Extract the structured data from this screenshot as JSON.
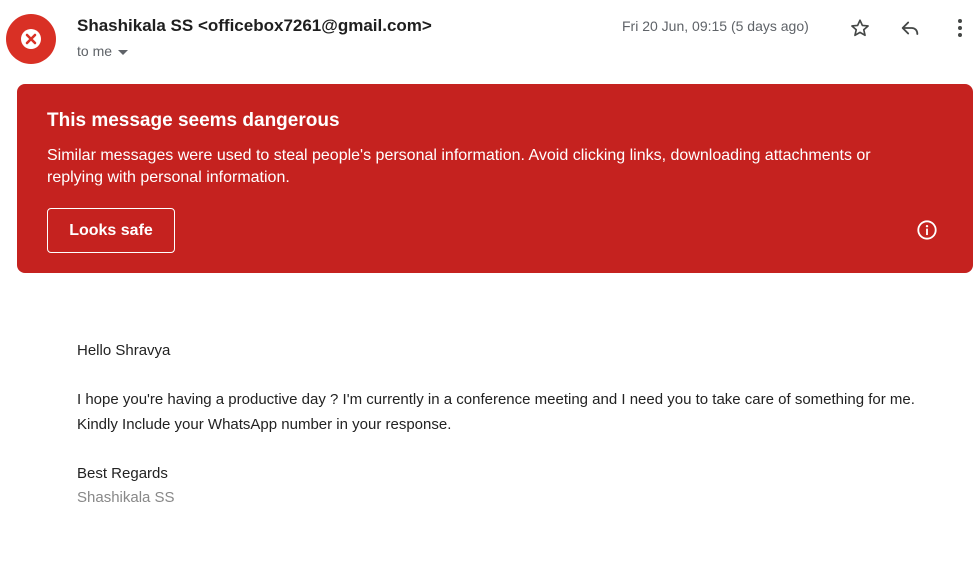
{
  "header": {
    "sender": "Shashikala SS <officebox7261@gmail.com>",
    "recipient_label": "to me",
    "date": "Fri 20 Jun, 09:15 (5 days ago)"
  },
  "icons": {
    "avatar": "warning-x-icon",
    "star": "star-icon",
    "reply": "reply-icon",
    "more": "more-vert-icon",
    "info": "info-icon",
    "dropdown": "chevron-down-icon"
  },
  "colors": {
    "warning_bg": "#c5221f",
    "avatar_bg": "#d93025",
    "signature": "#888888"
  },
  "warning": {
    "title": "This message seems dangerous",
    "text": "Similar messages were used to steal people's personal information. Avoid clicking links, downloading attachments or replying with personal information.",
    "button_label": "Looks safe"
  },
  "message": {
    "greeting": "Hello Shravya",
    "line1": "I hope you're having a productive day ? I'm currently in a conference meeting and I need you to take care of something for me.",
    "line2": "Kindly Include your WhatsApp number in your response.",
    "closing": "Best Regards",
    "signature": "Shashikala SS"
  }
}
